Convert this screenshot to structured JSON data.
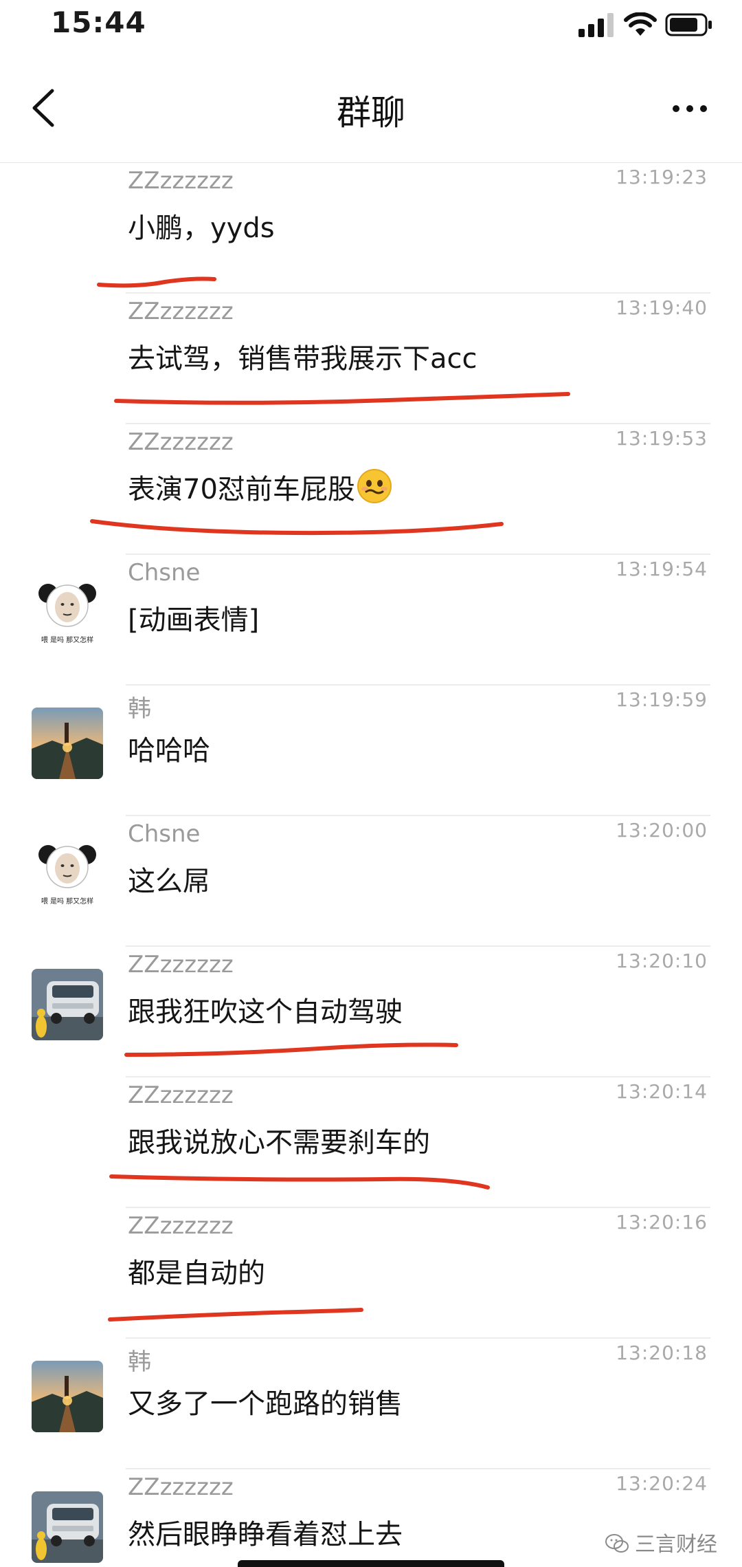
{
  "status_bar": {
    "time": "15:44"
  },
  "nav": {
    "title": "群聊"
  },
  "colors": {
    "underline": "#e0361f",
    "divider": "#ececec",
    "meta": "#9a9a9a"
  },
  "messages": [
    {
      "sender": "ZZzzzzzz",
      "time": "13:19:23",
      "text": "小鹏，yyds",
      "avatar": "none",
      "underlined": true
    },
    {
      "sender": "ZZzzzzzz",
      "time": "13:19:40",
      "text": "去试驾，销售带我展示下acc",
      "avatar": "none",
      "underlined": true
    },
    {
      "sender": "ZZzzzzzz",
      "time": "13:19:53",
      "text": "表演70怼前车屁股",
      "avatar": "none",
      "underlined": true,
      "emoji": "awkward-smile-emoji"
    },
    {
      "sender": "Chsne",
      "time": "13:19:54",
      "text": "[动画表情]",
      "avatar": "panda",
      "avatar_caption": "喂 是吗 那又怎样",
      "underlined": false
    },
    {
      "sender": "韩",
      "time": "13:19:59",
      "text": "哈哈哈",
      "avatar": "landscape",
      "underlined": false
    },
    {
      "sender": "Chsne",
      "time": "13:20:00",
      "text": "这么屌",
      "avatar": "panda",
      "avatar_caption": "喂 是吗 那又怎样",
      "underlined": false
    },
    {
      "sender": "ZZzzzzzz",
      "time": "13:20:10",
      "text": "跟我狂吹这个自动驾驶",
      "avatar": "car",
      "underlined": true
    },
    {
      "sender": "ZZzzzzzz",
      "time": "13:20:14",
      "text": "跟我说放心不需要刹车的",
      "avatar": "none",
      "underlined": true
    },
    {
      "sender": "ZZzzzzzz",
      "time": "13:20:16",
      "text": "都是自动的",
      "avatar": "none",
      "underlined": true
    },
    {
      "sender": "韩",
      "time": "13:20:18",
      "text": "又多了一个跑路的销售",
      "avatar": "landscape",
      "underlined": false
    },
    {
      "sender": "ZZzzzzzz",
      "time": "13:20:24",
      "text": "然后眼睁睁看着怼上去",
      "avatar": "car",
      "underlined": false
    }
  ],
  "watermark": {
    "text": "三言财经"
  }
}
